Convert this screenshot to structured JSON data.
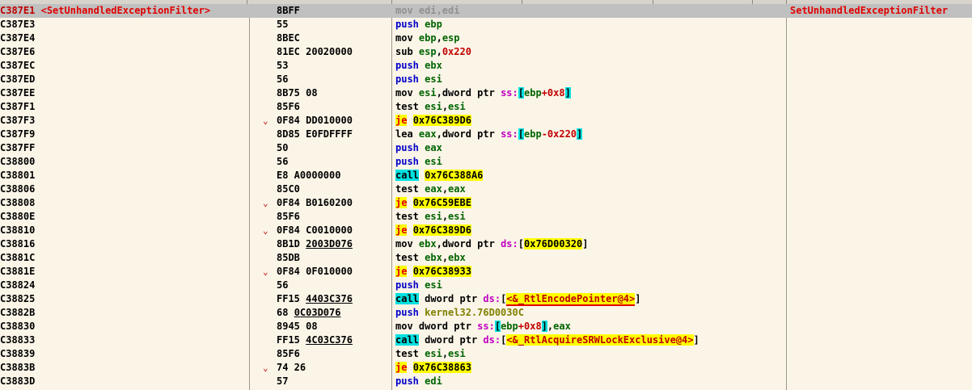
{
  "colors": {
    "background": "#fbf5e8",
    "selected_row": "#c0c0c0",
    "label_red": "#e00000",
    "jump_highlight": "#ffff00",
    "call_highlight": "#00e0e0",
    "register_green": "#006400",
    "push_blue": "#0000c8",
    "segment_magenta": "#c000c0"
  },
  "rows": [
    {
      "addr": "C387E1",
      "label": "<SetUnhandledExceptionFilter>",
      "arrow": "",
      "bytes": [
        {
          "t": "8BFF"
        }
      ],
      "dis": [
        {
          "c": "m-nop",
          "t": "mov edi,edi"
        }
      ],
      "comment": "SetUnhandledExceptionFilter"
    },
    {
      "addr": "C387E3",
      "label": "",
      "arrow": "",
      "bytes": [
        {
          "t": "55"
        }
      ],
      "dis": [
        {
          "c": "m-push",
          "t": "push "
        },
        {
          "c": "t-reg",
          "t": "ebp"
        }
      ],
      "comment": ""
    },
    {
      "addr": "C387E4",
      "label": "",
      "arrow": "",
      "bytes": [
        {
          "t": "8BEC"
        }
      ],
      "dis": [
        {
          "c": "m-mov",
          "t": "mov "
        },
        {
          "c": "t-reg",
          "t": "ebp"
        },
        {
          "c": "t-plain",
          "t": ","
        },
        {
          "c": "t-reg",
          "t": "esp"
        }
      ],
      "comment": ""
    },
    {
      "addr": "C387E6",
      "label": "",
      "arrow": "",
      "bytes": [
        {
          "t": "81EC 20020000"
        }
      ],
      "dis": [
        {
          "c": "m-sub",
          "t": "sub "
        },
        {
          "c": "t-reg",
          "t": "esp"
        },
        {
          "c": "t-plain",
          "t": ","
        },
        {
          "c": "t-imm",
          "t": "0x220"
        }
      ],
      "comment": ""
    },
    {
      "addr": "C387EC",
      "label": "",
      "arrow": "",
      "bytes": [
        {
          "t": "53"
        }
      ],
      "dis": [
        {
          "c": "m-push",
          "t": "push "
        },
        {
          "c": "t-reg",
          "t": "ebx"
        }
      ],
      "comment": ""
    },
    {
      "addr": "C387ED",
      "label": "",
      "arrow": "",
      "bytes": [
        {
          "t": "56"
        }
      ],
      "dis": [
        {
          "c": "m-push",
          "t": "push "
        },
        {
          "c": "t-reg",
          "t": "esi"
        }
      ],
      "comment": ""
    },
    {
      "addr": "C387EE",
      "label": "",
      "arrow": "",
      "bytes": [
        {
          "t": "8B75 08"
        }
      ],
      "dis": [
        {
          "c": "m-mov",
          "t": "mov "
        },
        {
          "c": "t-reg",
          "t": "esi"
        },
        {
          "c": "t-plain",
          "t": ","
        },
        {
          "c": "t-ptr",
          "t": "dword ptr "
        },
        {
          "c": "t-seg",
          "t": "ss:"
        },
        {
          "c": "br-hi",
          "t": "["
        },
        {
          "c": "t-reg",
          "t": "ebp"
        },
        {
          "c": "t-imm",
          "t": "+0x8"
        },
        {
          "c": "br-hi",
          "t": "]"
        }
      ],
      "comment": ""
    },
    {
      "addr": "C387F1",
      "label": "",
      "arrow": "",
      "bytes": [
        {
          "t": "85F6"
        }
      ],
      "dis": [
        {
          "c": "m-test",
          "t": "test "
        },
        {
          "c": "t-reg",
          "t": "esi"
        },
        {
          "c": "t-plain",
          "t": ","
        },
        {
          "c": "t-reg",
          "t": "esi"
        }
      ],
      "comment": ""
    },
    {
      "addr": "C387F3",
      "label": "",
      "arrow": "⌄",
      "bytes": [
        {
          "t": "0F84 DD010000"
        }
      ],
      "dis": [
        {
          "c": "m-jcc",
          "t": "je"
        },
        {
          "c": "t-plain",
          "t": " "
        },
        {
          "c": "t-target",
          "t": "0x76C389D6"
        }
      ],
      "comment": ""
    },
    {
      "addr": "C387F9",
      "label": "",
      "arrow": "",
      "bytes": [
        {
          "t": "8D85 E0FDFFFF"
        }
      ],
      "dis": [
        {
          "c": "m-lea",
          "t": "lea "
        },
        {
          "c": "t-reg",
          "t": "eax"
        },
        {
          "c": "t-plain",
          "t": ","
        },
        {
          "c": "t-ptr",
          "t": "dword ptr "
        },
        {
          "c": "t-seg",
          "t": "ss:"
        },
        {
          "c": "br-hi",
          "t": "["
        },
        {
          "c": "t-reg",
          "t": "ebp"
        },
        {
          "c": "t-imm",
          "t": "-0x220"
        },
        {
          "c": "br-hi",
          "t": "]"
        }
      ],
      "comment": ""
    },
    {
      "addr": "C387FF",
      "label": "",
      "arrow": "",
      "bytes": [
        {
          "t": "50"
        }
      ],
      "dis": [
        {
          "c": "m-push",
          "t": "push "
        },
        {
          "c": "t-reg",
          "t": "eax"
        }
      ],
      "comment": ""
    },
    {
      "addr": "C38800",
      "label": "",
      "arrow": "",
      "bytes": [
        {
          "t": "56"
        }
      ],
      "dis": [
        {
          "c": "m-push",
          "t": "push "
        },
        {
          "c": "t-reg",
          "t": "esi"
        }
      ],
      "comment": ""
    },
    {
      "addr": "C38801",
      "label": "",
      "arrow": "",
      "bytes": [
        {
          "t": "E8 A0000000"
        }
      ],
      "dis": [
        {
          "c": "m-call",
          "t": "call"
        },
        {
          "c": "t-plain",
          "t": " "
        },
        {
          "c": "t-target",
          "t": "0x76C388A6"
        }
      ],
      "comment": ""
    },
    {
      "addr": "C38806",
      "label": "",
      "arrow": "",
      "bytes": [
        {
          "t": "85C0"
        }
      ],
      "dis": [
        {
          "c": "m-test",
          "t": "test "
        },
        {
          "c": "t-reg",
          "t": "eax"
        },
        {
          "c": "t-plain",
          "t": ","
        },
        {
          "c": "t-reg",
          "t": "eax"
        }
      ],
      "comment": ""
    },
    {
      "addr": "C38808",
      "label": "",
      "arrow": "⌄",
      "bytes": [
        {
          "t": "0F84 B0160200"
        }
      ],
      "dis": [
        {
          "c": "m-jcc",
          "t": "je"
        },
        {
          "c": "t-plain",
          "t": " "
        },
        {
          "c": "t-target",
          "t": "0x76C59EBE"
        }
      ],
      "comment": ""
    },
    {
      "addr": "C3880E",
      "label": "",
      "arrow": "",
      "bytes": [
        {
          "t": "85F6"
        }
      ],
      "dis": [
        {
          "c": "m-test",
          "t": "test "
        },
        {
          "c": "t-reg",
          "t": "esi"
        },
        {
          "c": "t-plain",
          "t": ","
        },
        {
          "c": "t-reg",
          "t": "esi"
        }
      ],
      "comment": ""
    },
    {
      "addr": "C38810",
      "label": "",
      "arrow": "⌄",
      "bytes": [
        {
          "t": "0F84 C0010000"
        }
      ],
      "dis": [
        {
          "c": "m-jcc",
          "t": "je"
        },
        {
          "c": "t-plain",
          "t": " "
        },
        {
          "c": "t-target",
          "t": "0x76C389D6"
        }
      ],
      "comment": ""
    },
    {
      "addr": "C38816",
      "label": "",
      "arrow": "",
      "bytes": [
        {
          "t": "8B1D "
        },
        {
          "t": "2003D076",
          "u": true
        }
      ],
      "dis": [
        {
          "c": "m-mov",
          "t": "mov "
        },
        {
          "c": "t-reg",
          "t": "ebx"
        },
        {
          "c": "t-plain",
          "t": ","
        },
        {
          "c": "t-ptr",
          "t": "dword ptr "
        },
        {
          "c": "t-seg",
          "t": "ds:"
        },
        {
          "c": "t-plain",
          "t": "["
        },
        {
          "c": "t-target",
          "t": "0x76D00320"
        },
        {
          "c": "t-plain",
          "t": "]"
        }
      ],
      "comment": ""
    },
    {
      "addr": "C3881C",
      "label": "",
      "arrow": "",
      "bytes": [
        {
          "t": "85DB"
        }
      ],
      "dis": [
        {
          "c": "m-test",
          "t": "test "
        },
        {
          "c": "t-reg",
          "t": "ebx"
        },
        {
          "c": "t-plain",
          "t": ","
        },
        {
          "c": "t-reg",
          "t": "ebx"
        }
      ],
      "comment": ""
    },
    {
      "addr": "C3881E",
      "label": "",
      "arrow": "⌄",
      "bytes": [
        {
          "t": "0F84 0F010000"
        }
      ],
      "dis": [
        {
          "c": "m-jcc",
          "t": "je"
        },
        {
          "c": "t-plain",
          "t": " "
        },
        {
          "c": "t-target",
          "t": "0x76C38933"
        }
      ],
      "comment": ""
    },
    {
      "addr": "C38824",
      "label": "",
      "arrow": "",
      "bytes": [
        {
          "t": "56"
        }
      ],
      "dis": [
        {
          "c": "m-push",
          "t": "push "
        },
        {
          "c": "t-reg",
          "t": "esi"
        }
      ],
      "comment": ""
    },
    {
      "addr": "C38825",
      "label": "",
      "arrow": "",
      "bytes": [
        {
          "t": "FF15 "
        },
        {
          "t": "4403C376",
          "u": true
        }
      ],
      "dis": [
        {
          "c": "m-call",
          "t": "call"
        },
        {
          "c": "t-plain",
          "t": " "
        },
        {
          "c": "t-ptr",
          "t": "dword ptr "
        },
        {
          "c": "t-seg",
          "t": "ds:"
        },
        {
          "c": "t-plain",
          "t": "["
        },
        {
          "c": "t-sym ul-red",
          "t": "<&_RtlEncodePointer@4>"
        },
        {
          "c": "t-plain",
          "t": "]"
        }
      ],
      "comment": ""
    },
    {
      "addr": "C3882B",
      "label": "",
      "arrow": "",
      "bytes": [
        {
          "t": "68 "
        },
        {
          "t": "0C03D076",
          "u": true
        }
      ],
      "dis": [
        {
          "c": "m-push",
          "t": "push "
        },
        {
          "c": "t-kern",
          "t": "kernel32.76D0030C"
        }
      ],
      "comment": ""
    },
    {
      "addr": "C38830",
      "label": "",
      "arrow": "",
      "bytes": [
        {
          "t": "8945 08"
        }
      ],
      "dis": [
        {
          "c": "m-mov",
          "t": "mov "
        },
        {
          "c": "t-ptr",
          "t": "dword ptr "
        },
        {
          "c": "t-seg",
          "t": "ss:"
        },
        {
          "c": "br-hi",
          "t": "["
        },
        {
          "c": "t-reg",
          "t": "ebp"
        },
        {
          "c": "t-imm",
          "t": "+0x8"
        },
        {
          "c": "br-hi",
          "t": "]"
        },
        {
          "c": "t-plain",
          "t": ","
        },
        {
          "c": "t-reg",
          "t": "eax"
        }
      ],
      "comment": ""
    },
    {
      "addr": "C38833",
      "label": "",
      "arrow": "",
      "bytes": [
        {
          "t": "FF15 "
        },
        {
          "t": "4C03C376",
          "u": true
        }
      ],
      "dis": [
        {
          "c": "m-call",
          "t": "call"
        },
        {
          "c": "t-plain",
          "t": " "
        },
        {
          "c": "t-ptr",
          "t": "dword ptr "
        },
        {
          "c": "t-seg",
          "t": "ds:"
        },
        {
          "c": "t-plain",
          "t": "["
        },
        {
          "c": "t-sym",
          "t": "<&_RtlAcquireSRWLockExclusive@4>"
        },
        {
          "c": "t-plain",
          "t": "]"
        }
      ],
      "comment": ""
    },
    {
      "addr": "C38839",
      "label": "",
      "arrow": "",
      "bytes": [
        {
          "t": "85F6"
        }
      ],
      "dis": [
        {
          "c": "m-test",
          "t": "test "
        },
        {
          "c": "t-reg",
          "t": "esi"
        },
        {
          "c": "t-plain",
          "t": ","
        },
        {
          "c": "t-reg",
          "t": "esi"
        }
      ],
      "comment": ""
    },
    {
      "addr": "C3883B",
      "label": "",
      "arrow": "⌄",
      "bytes": [
        {
          "t": "74 26"
        }
      ],
      "dis": [
        {
          "c": "m-jcc",
          "t": "je"
        },
        {
          "c": "t-plain",
          "t": " "
        },
        {
          "c": "t-target",
          "t": "0x76C38863"
        }
      ],
      "comment": ""
    },
    {
      "addr": "C3883D",
      "label": "",
      "arrow": "",
      "bytes": [
        {
          "t": "57"
        }
      ],
      "dis": [
        {
          "c": "m-push",
          "t": "push "
        },
        {
          "c": "t-reg",
          "t": "edi"
        }
      ],
      "comment": ""
    }
  ]
}
